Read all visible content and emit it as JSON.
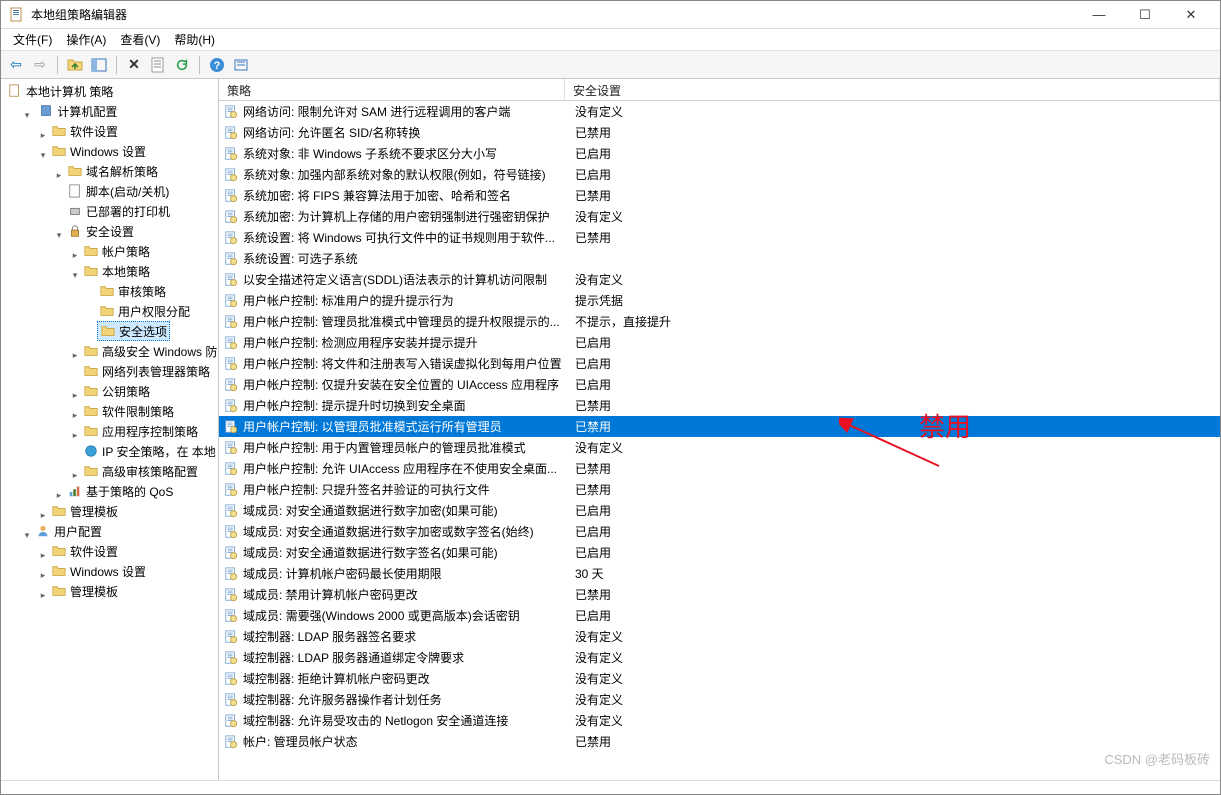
{
  "window": {
    "title": "本地组策略编辑器",
    "controls": {
      "min": "—",
      "max": "☐",
      "close": "✕"
    }
  },
  "menu": {
    "file": "文件(F)",
    "action": "操作(A)",
    "view": "查看(V)",
    "help": "帮助(H)"
  },
  "toolbar": {
    "back": "←",
    "forward": "→",
    "up": "↑",
    "show": "▭",
    "delete": "✕",
    "prop": "☰",
    "refresh": "⟳",
    "help": "?"
  },
  "tree": {
    "root": "本地计算机 策略",
    "computer_config": "计算机配置",
    "software_settings": "软件设置",
    "windows_settings": "Windows 设置",
    "name_res_policy": "域名解析策略",
    "scripts": "脚本(启动/关机)",
    "deployed_printers": "已部署的打印机",
    "security_settings": "安全设置",
    "account_policies": "帐户策略",
    "local_policies": "本地策略",
    "audit_policy": "审核策略",
    "user_rights": "用户权限分配",
    "security_options": "安全选项",
    "adv_windows_fw": "高级安全 Windows 防",
    "network_list": "网络列表管理器策略",
    "public_key": "公钥策略",
    "software_restrict": "软件限制策略",
    "app_control": "应用程序控制策略",
    "ip_security": "IP 安全策略，在 本地",
    "adv_audit": "高级审核策略配置",
    "qos": "基于策略的 QoS",
    "admin_templates": "管理模板",
    "user_config": "用户配置",
    "u_software": "软件设置",
    "u_windows": "Windows 设置",
    "u_admin": "管理模板"
  },
  "columns": {
    "policy": "策略",
    "setting": "安全设置"
  },
  "rows": [
    {
      "policy": "网络访问: 限制允许对 SAM 进行远程调用的客户端",
      "setting": "没有定义"
    },
    {
      "policy": "网络访问: 允许匿名 SID/名称转换",
      "setting": "已禁用"
    },
    {
      "policy": "系统对象: 非 Windows 子系统不要求区分大小写",
      "setting": "已启用"
    },
    {
      "policy": "系统对象: 加强内部系统对象的默认权限(例如，符号链接)",
      "setting": "已启用"
    },
    {
      "policy": "系统加密: 将 FIPS 兼容算法用于加密、哈希和签名",
      "setting": "已禁用"
    },
    {
      "policy": "系统加密: 为计算机上存储的用户密钥强制进行强密钥保护",
      "setting": "没有定义"
    },
    {
      "policy": "系统设置: 将 Windows 可执行文件中的证书规则用于软件...",
      "setting": "已禁用"
    },
    {
      "policy": "系统设置: 可选子系统",
      "setting": ""
    },
    {
      "policy": "以安全描述符定义语言(SDDL)语法表示的计算机访问限制",
      "setting": "没有定义"
    },
    {
      "policy": "用户帐户控制: 标准用户的提升提示行为",
      "setting": "提示凭据"
    },
    {
      "policy": "用户帐户控制: 管理员批准模式中管理员的提升权限提示的...",
      "setting": "不提示，直接提升"
    },
    {
      "policy": "用户帐户控制: 检测应用程序安装并提示提升",
      "setting": "已启用"
    },
    {
      "policy": "用户帐户控制: 将文件和注册表写入错误虚拟化到每用户位置",
      "setting": "已启用"
    },
    {
      "policy": "用户帐户控制: 仅提升安装在安全位置的 UIAccess 应用程序",
      "setting": "已启用"
    },
    {
      "policy": "用户帐户控制: 提示提升时切换到安全桌面",
      "setting": "已禁用"
    },
    {
      "policy": "用户帐户控制: 以管理员批准模式运行所有管理员",
      "setting": "已禁用",
      "selected": true
    },
    {
      "policy": "用户帐户控制: 用于内置管理员帐户的管理员批准模式",
      "setting": "没有定义"
    },
    {
      "policy": "用户帐户控制: 允许 UIAccess 应用程序在不使用安全桌面...",
      "setting": "已禁用"
    },
    {
      "policy": "用户帐户控制: 只提升签名并验证的可执行文件",
      "setting": "已禁用"
    },
    {
      "policy": "域成员: 对安全通道数据进行数字加密(如果可能)",
      "setting": "已启用"
    },
    {
      "policy": "域成员: 对安全通道数据进行数字加密或数字签名(始终)",
      "setting": "已启用"
    },
    {
      "policy": "域成员: 对安全通道数据进行数字签名(如果可能)",
      "setting": "已启用"
    },
    {
      "policy": "域成员: 计算机帐户密码最长使用期限",
      "setting": "30 天"
    },
    {
      "policy": "域成员: 禁用计算机帐户密码更改",
      "setting": "已禁用"
    },
    {
      "policy": "域成员: 需要强(Windows 2000 或更高版本)会话密钥",
      "setting": "已启用"
    },
    {
      "policy": "域控制器: LDAP 服务器签名要求",
      "setting": "没有定义"
    },
    {
      "policy": "域控制器: LDAP 服务器通道绑定令牌要求",
      "setting": "没有定义"
    },
    {
      "policy": "域控制器: 拒绝计算机帐户密码更改",
      "setting": "没有定义"
    },
    {
      "policy": "域控制器: 允许服务器操作者计划任务",
      "setting": "没有定义"
    },
    {
      "policy": "域控制器: 允许易受攻击的 Netlogon 安全通道连接",
      "setting": "没有定义"
    },
    {
      "policy": "帐户: 管理员帐户状态",
      "setting": "已禁用"
    }
  ],
  "annotation": {
    "label": "禁用"
  },
  "watermark": "CSDN @老码板砖"
}
